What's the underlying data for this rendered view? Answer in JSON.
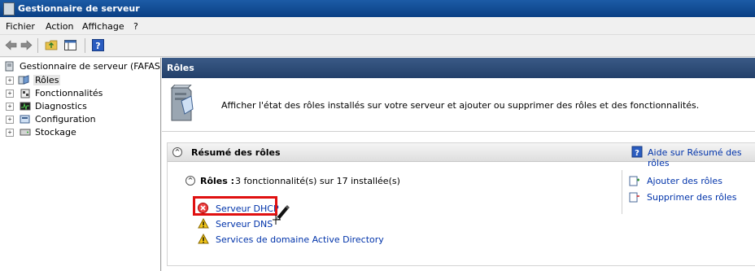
{
  "window": {
    "title": "Gestionnaire de serveur"
  },
  "menu": {
    "items": [
      "Fichier",
      "Action",
      "Affichage",
      "?"
    ]
  },
  "tree": {
    "root": "Gestionnaire de serveur (FAFASER",
    "items": [
      "Rôles",
      "Fonctionnalités",
      "Diagnostics",
      "Configuration",
      "Stockage"
    ]
  },
  "main": {
    "header": "Rôles",
    "intro": "Afficher l'état des rôles installés sur votre serveur et ajouter ou supprimer des rôles et des fonctionnalités.",
    "summary_title": "Résumé des rôles",
    "help_link": "Aide sur Résumé des rôles",
    "roles_label": "Rôles :",
    "roles_count": "3 fonctionnalité(s) sur 17 installée(s)",
    "roles": [
      "Serveur DHCP",
      "Serveur DNS",
      "Services de domaine Active Directory"
    ],
    "actions": [
      "Ajouter des rôles",
      "Supprimer des rôles"
    ]
  }
}
